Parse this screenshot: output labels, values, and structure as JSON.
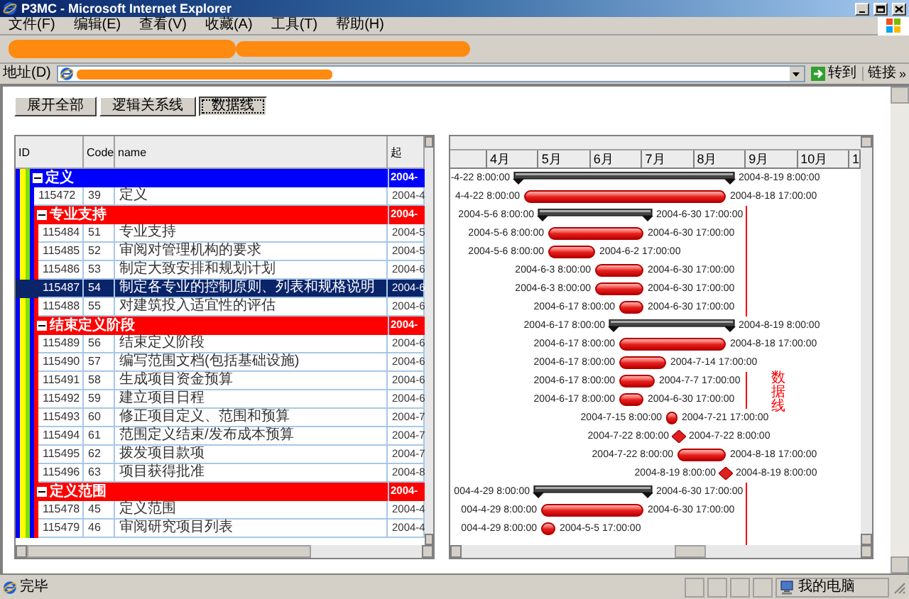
{
  "window": {
    "title": "P3MC - Microsoft Internet Explorer"
  },
  "menu": [
    "文件(F)",
    "编辑(E)",
    "查看(V)",
    "收藏(A)",
    "工具(T)",
    "帮助(H)"
  ],
  "address_bar": {
    "label": "地址(D)",
    "go_button": "转到",
    "links": "链接",
    "chevron": "»"
  },
  "page": {
    "buttons": [
      {
        "label": "展开全部",
        "pressed": false
      },
      {
        "label": "逻辑关系线",
        "pressed": false
      },
      {
        "label": "数据线",
        "pressed": true
      }
    ]
  },
  "grid": {
    "columns": [
      "ID",
      "Code",
      "name",
      "起"
    ],
    "rows": [
      {
        "kind": "group",
        "name": "定义",
        "start": "2004-",
        "color": "#0000ff",
        "expanded": true,
        "children": [
          {
            "kind": "task",
            "id": "115472",
            "code": "39",
            "name": "定义",
            "start": "2004-4",
            "selected": false
          },
          {
            "kind": "group",
            "name": "专业支持",
            "start": "2004-",
            "color": "#ff0000",
            "expanded": true,
            "children": [
              {
                "kind": "task",
                "id": "115484",
                "code": "51",
                "name": "专业支持",
                "start": "2004-5",
                "selected": false
              },
              {
                "kind": "task",
                "id": "115485",
                "code": "52",
                "name": "审阅对管理机构的要求",
                "start": "2004-5",
                "selected": false
              },
              {
                "kind": "task",
                "id": "115486",
                "code": "53",
                "name": "制定大致安排和规划计划",
                "start": "2004-6",
                "selected": false
              },
              {
                "kind": "task",
                "id": "115487",
                "code": "54",
                "name": "制定各专业的控制原则、列表和规格说明",
                "start": "2004-6",
                "selected": true
              },
              {
                "kind": "task",
                "id": "115488",
                "code": "55",
                "name": "对建筑投入适宜性的评估",
                "start": "2004-6",
                "selected": false
              }
            ]
          },
          {
            "kind": "group",
            "name": "结束定义阶段",
            "start": "2004-",
            "color": "#ff0000",
            "expanded": true,
            "children": [
              {
                "kind": "task",
                "id": "115489",
                "code": "56",
                "name": "结束定义阶段",
                "start": "2004-6",
                "selected": false
              },
              {
                "kind": "task",
                "id": "115490",
                "code": "57",
                "name": "编写范围文档(包括基础设施)",
                "start": "2004-6",
                "selected": false
              },
              {
                "kind": "task",
                "id": "115491",
                "code": "58",
                "name": "生成项目资金预算",
                "start": "2004-6",
                "selected": false
              },
              {
                "kind": "task",
                "id": "115492",
                "code": "59",
                "name": "建立项目日程",
                "start": "2004-6",
                "selected": false
              },
              {
                "kind": "task",
                "id": "115493",
                "code": "60",
                "name": "修正项目定义、范围和预算",
                "start": "2004-7",
                "selected": false
              },
              {
                "kind": "task",
                "id": "115494",
                "code": "61",
                "name": "范围定义结束/发布成本预算",
                "start": "2004-7",
                "selected": false
              },
              {
                "kind": "task",
                "id": "115495",
                "code": "62",
                "name": "拨发项目款项",
                "start": "2004-7",
                "selected": false
              },
              {
                "kind": "task",
                "id": "115496",
                "code": "63",
                "name": "项目获得批准",
                "start": "2004-8",
                "selected": false
              }
            ]
          },
          {
            "kind": "group",
            "name": "定义范围",
            "start": "2004-",
            "color": "#ff0000",
            "expanded": true,
            "children": [
              {
                "kind": "task",
                "id": "115478",
                "code": "45",
                "name": "定义范围",
                "start": "2004-4",
                "selected": false
              },
              {
                "kind": "task",
                "id": "115479",
                "code": "46",
                "name": "审阅研究项目列表",
                "start": "2004-4",
                "selected": false
              }
            ]
          }
        ]
      }
    ]
  },
  "gantt": {
    "months": [
      "4月",
      "5月",
      "6月",
      "7月",
      "8月",
      "9月",
      "10月",
      "1"
    ],
    "today_label": "数据线",
    "rows": [
      {
        "kind": "summary",
        "start_label": "-4-22 8:00:00",
        "end_label": "2004-8-19 8:00:00"
      },
      {
        "kind": "task",
        "start_label": "4-4-22 8:00:00",
        "end_label": "2004-8-18 17:00:00"
      },
      {
        "kind": "summary",
        "start_label": "2004-5-6 8:00:00",
        "end_label": "2004-6-30 17:00:00"
      },
      {
        "kind": "task",
        "start_label": "2004-5-6 8:00:00",
        "end_label": "2004-6-30 17:00:00"
      },
      {
        "kind": "task",
        "start_label": "2004-5-6 8:00:00",
        "end_label": "2004-6-2 17:00:00"
      },
      {
        "kind": "task",
        "start_label": "2004-6-3 8:00:00",
        "end_label": "2004-6-30 17:00:00"
      },
      {
        "kind": "task",
        "start_label": "2004-6-3 8:00:00",
        "end_label": "2004-6-30 17:00:00"
      },
      {
        "kind": "task",
        "start_label": "2004-6-17 8:00:00",
        "end_label": "2004-6-30 17:00:00"
      },
      {
        "kind": "summary",
        "start_label": "2004-6-17 8:00:00",
        "end_label": "2004-8-19 8:00:00"
      },
      {
        "kind": "task",
        "start_label": "2004-6-17 8:00:00",
        "end_label": "2004-8-18 17:00:00"
      },
      {
        "kind": "task",
        "start_label": "2004-6-17 8:00:00",
        "end_label": "2004-7-14 17:00:00"
      },
      {
        "kind": "task",
        "start_label": "2004-6-17 8:00:00",
        "end_label": "2004-7-7 17:00:00"
      },
      {
        "kind": "task",
        "start_label": "2004-6-17 8:00:00",
        "end_label": "2004-6-30 17:00:00"
      },
      {
        "kind": "task",
        "start_label": "2004-7-15 8:00:00",
        "end_label": "2004-7-21 17:00:00"
      },
      {
        "kind": "milestone",
        "start_label": "2004-7-22 8:00:00",
        "end_label": "2004-7-22 8:00:00"
      },
      {
        "kind": "task",
        "start_label": "2004-7-22 8:00:00",
        "end_label": "2004-8-18 17:00:00"
      },
      {
        "kind": "milestone",
        "start_label": "2004-8-19 8:00:00",
        "end_label": "2004-8-19 8:00:00"
      },
      {
        "kind": "summary",
        "start_label": "004-4-29 8:00:00",
        "end_label": "2004-6-30 17:00:00"
      },
      {
        "kind": "task",
        "start_label": "004-4-29 8:00:00",
        "end_label": "2004-6-30 17:00:00"
      },
      {
        "kind": "task",
        "start_label": "004-4-29 8:00:00",
        "end_label": "2004-5-5 17:00:00"
      }
    ]
  },
  "status_bar": {
    "text": "完毕",
    "zone": "我的电脑"
  }
}
